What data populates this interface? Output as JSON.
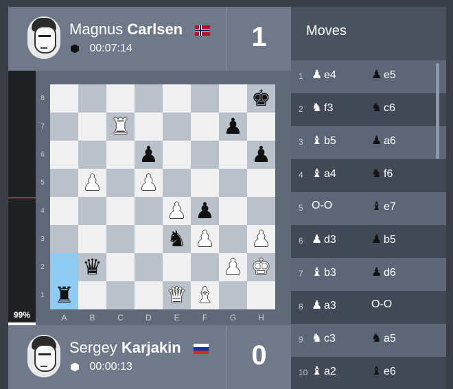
{
  "players": {
    "top": {
      "first": "Magnus",
      "last": "Carlsen",
      "clock": "00:07:14",
      "score": "1",
      "side": "black"
    },
    "bottom": {
      "first": "Sergey",
      "last": "Karjakin",
      "clock": "00:00:13",
      "score": "0",
      "side": "white"
    }
  },
  "evaluation": {
    "label": "99%",
    "white_fraction": 0.01
  },
  "board": {
    "files": [
      "A",
      "B",
      "C",
      "D",
      "E",
      "F",
      "G",
      "H"
    ],
    "ranks": [
      "8",
      "7",
      "6",
      "5",
      "4",
      "3",
      "2",
      "1"
    ],
    "highlighted": [
      "a2",
      "a1"
    ],
    "pieces": [
      {
        "sq": "h8",
        "glyph": "♚",
        "color": "black",
        "name": "black-king"
      },
      {
        "sq": "c7",
        "glyph": "♜",
        "color": "white",
        "name": "white-rook"
      },
      {
        "sq": "g7",
        "glyph": "♟",
        "color": "black",
        "name": "black-pawn"
      },
      {
        "sq": "d6",
        "glyph": "♟",
        "color": "black",
        "name": "black-pawn"
      },
      {
        "sq": "h6",
        "glyph": "♟",
        "color": "black",
        "name": "black-pawn"
      },
      {
        "sq": "b5",
        "glyph": "♟",
        "color": "white",
        "name": "white-pawn"
      },
      {
        "sq": "d5",
        "glyph": "♟",
        "color": "white",
        "name": "white-pawn"
      },
      {
        "sq": "e4",
        "glyph": "♟",
        "color": "white",
        "name": "white-pawn"
      },
      {
        "sq": "f4",
        "glyph": "♟",
        "color": "black",
        "name": "black-pawn"
      },
      {
        "sq": "e3",
        "glyph": "♞",
        "color": "black",
        "name": "black-knight"
      },
      {
        "sq": "f3",
        "glyph": "♟",
        "color": "white",
        "name": "white-pawn"
      },
      {
        "sq": "h3",
        "glyph": "♟",
        "color": "white",
        "name": "white-pawn"
      },
      {
        "sq": "b2",
        "glyph": "♛",
        "color": "black",
        "name": "black-queen"
      },
      {
        "sq": "g2",
        "glyph": "♟",
        "color": "white",
        "name": "white-pawn"
      },
      {
        "sq": "h2",
        "glyph": "♚",
        "color": "white",
        "name": "white-king"
      },
      {
        "sq": "a1",
        "glyph": "♜",
        "color": "black",
        "name": "black-rook"
      },
      {
        "sq": "e1",
        "glyph": "♛",
        "color": "white",
        "name": "white-queen"
      },
      {
        "sq": "f1",
        "glyph": "♝",
        "color": "white",
        "name": "white-bishop"
      }
    ]
  },
  "moves_panel": {
    "title": "Moves",
    "moves": [
      {
        "n": "1",
        "w_icon": "♟",
        "w": "e4",
        "b_icon": "♟",
        "b": "e5"
      },
      {
        "n": "2",
        "w_icon": "♞",
        "w": "f3",
        "b_icon": "♞",
        "b": "c6"
      },
      {
        "n": "3",
        "w_icon": "♝",
        "w": "b5",
        "b_icon": "♟",
        "b": "a6"
      },
      {
        "n": "4",
        "w_icon": "♝",
        "w": "a4",
        "b_icon": "♞",
        "b": "f6"
      },
      {
        "n": "5",
        "w_icon": "",
        "w": "O-O",
        "b_icon": "♝",
        "b": "e7"
      },
      {
        "n": "6",
        "w_icon": "♟",
        "w": "d3",
        "b_icon": "♟",
        "b": "b5"
      },
      {
        "n": "7",
        "w_icon": "♝",
        "w": "b3",
        "b_icon": "♟",
        "b": "d6"
      },
      {
        "n": "8",
        "w_icon": "♟",
        "w": "a3",
        "b_icon": "",
        "b": "O-O"
      },
      {
        "n": "9",
        "w_icon": "♞",
        "w": "c3",
        "b_icon": "♞",
        "b": "a5"
      },
      {
        "n": "10",
        "w_icon": "♝",
        "w": "a2",
        "b_icon": "♝",
        "b": "e6"
      }
    ]
  },
  "colors": {
    "panel": "#6f7989",
    "light_square": "#f0f0f0",
    "dark_square": "#bac1ca",
    "highlight": "#8fcaf2",
    "moves_bg": "#4a5260"
  },
  "icons": {
    "player_side_top": "hexagon-black-icon",
    "player_side_bottom": "hexagon-white-icon",
    "flag_top": "norway-flag-icon",
    "flag_bottom": "russia-flag-icon"
  }
}
